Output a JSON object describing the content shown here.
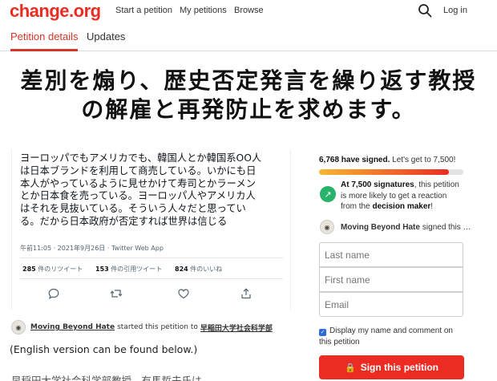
{
  "header": {
    "logo": "change.org",
    "nav": [
      "Start a petition",
      "My petitions",
      "Browse"
    ],
    "login": "Log in",
    "search_icon": "search-icon"
  },
  "tabs": {
    "details": "Petition details",
    "updates": "Updates",
    "active": "Petition details"
  },
  "title": {
    "line1": "差別を煽り、歴史否定発言を繰り返す教授",
    "line2": "の解雇と再発防止を求めます。"
  },
  "tweet": {
    "lines": [
      "ヨーロッパでもアメリカでも、韓国人とか韓国系OO人",
      "は日本ブランドを利用して商売している。いかにも日",
      "本人がやっているように見せかけて寿司とかラーメン",
      "とか日本食を売っている。ヨーロッパ人やアメリカ人",
      "はそれを見抜いている。そういう人々だと思ってい",
      "る。だから日本政府が否定すれば世界は信じる"
    ],
    "meta": "午前11:05 · 2021年9月26日 · Twitter Web App",
    "retweets": {
      "count": "285",
      "label": "件のリツイート"
    },
    "quotes": {
      "count": "153",
      "label": "件の引用ツイート"
    },
    "likes": {
      "count": "824",
      "label": "件のいいね"
    }
  },
  "starter": {
    "name": "Moving Beyond Hate",
    "action": "started this petition to",
    "target": "早稲田大学社会科学部"
  },
  "body": {
    "english_note": "(English version can be found below.)",
    "trailing": "早稲田大学社会科学部教授、有馬哲夫氏は"
  },
  "sidebar": {
    "signed_count": "6,768 have signed.",
    "signed_goal": "Let's get to 7,500!",
    "progress_fraction": 0.9024,
    "goal_bold": "At 7,500 signatures",
    "goal_text": ", this petition is more likely to get a reaction from the ",
    "goal_maker": "decision maker",
    "goal_end": "!",
    "recent_signer": "Moving Beyond Hate",
    "recent_action": "signed this …"
  },
  "form": {
    "last_name": "Last name",
    "first_name": "First name",
    "email": "Email",
    "consent": "Display my name and comment on this petition",
    "consent_checked": true,
    "submit": "Sign this petition"
  },
  "colors": {
    "brand": "#ec2c22",
    "tab_active": "#d8352a",
    "goal_green": "#27b36a",
    "checkbox_blue": "#2b6cd9"
  }
}
